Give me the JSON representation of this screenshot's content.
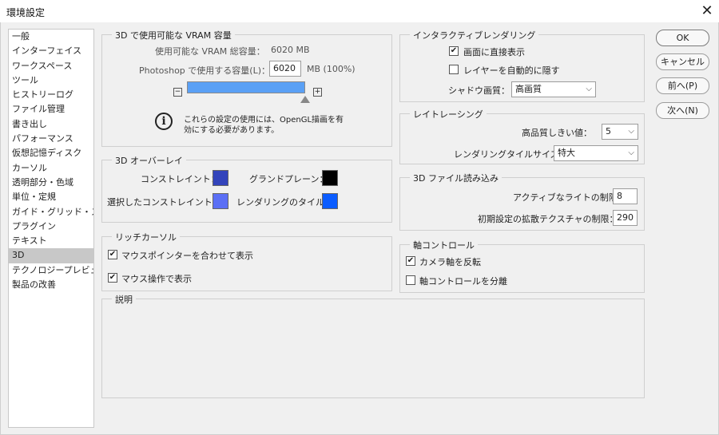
{
  "window": {
    "title": "環境設定",
    "close_glyph": "✕"
  },
  "sidebar": {
    "items": [
      {
        "label": "一般"
      },
      {
        "label": "インターフェイス"
      },
      {
        "label": "ワークスペース"
      },
      {
        "label": "ツール"
      },
      {
        "label": "ヒストリーログ"
      },
      {
        "label": "ファイル管理"
      },
      {
        "label": "書き出し"
      },
      {
        "label": "パフォーマンス"
      },
      {
        "label": "仮想記憶ディスク"
      },
      {
        "label": "カーソル"
      },
      {
        "label": "透明部分・色域"
      },
      {
        "label": "単位・定規"
      },
      {
        "label": "ガイド・グリッド・スライス"
      },
      {
        "label": "プラグイン"
      },
      {
        "label": "テキスト"
      },
      {
        "label": "3D"
      },
      {
        "label": "テクノロジープレビュー"
      },
      {
        "label": "製品の改善"
      }
    ],
    "selected": "3D"
  },
  "vram": {
    "legend": "3D で使用可能な VRAM 容量",
    "available_label": "使用可能な VRAM 総容量：",
    "available_value": "6020 MB",
    "use_label": "Photoshop で使用する容量(L)：",
    "use_value": "6020",
    "use_suffix": "MB (100%)",
    "slider_percent": 100,
    "slider_color": "#5aa0f5",
    "minus": "−",
    "plus": "+",
    "info_icon": "info-icon",
    "info_text_1": "これらの設定の使用には、OpenGL描画を有",
    "info_text_2": "効にする必要があります。"
  },
  "overlay": {
    "legend": "3D オーバーレイ",
    "constraint_label": "コンストレイント：",
    "constraint_color": "#3344bb",
    "ground_label": "グランドプレーン：",
    "ground_color": "#000000",
    "selected_constraint_label": "選択したコンストレイント：",
    "selected_constraint_color": "#5b6ff5",
    "render_tile_label": "レンダリングのタイル：",
    "render_tile_color": "#0a5cff"
  },
  "rich_cursor": {
    "legend": "リッチカーソル",
    "opt1": "マウスポインターを合わせて表示",
    "opt2": "マウス操作で表示"
  },
  "interactive": {
    "legend": "インタラクティブレンダリング",
    "opt1": "画面に直接表示",
    "opt2": "レイヤーを自動的に隠す",
    "shadow_label": "シャドウ画質：",
    "shadow_value": "高画質"
  },
  "raytrace": {
    "legend": "レイトレーシング",
    "threshold_label": "高品質しきい値：",
    "threshold_value": "5",
    "tile_label": "レンダリングタイルサイズ：",
    "tile_value": "特大"
  },
  "fileload": {
    "legend": "3D ファイル読み込み",
    "lights_label": "アクティブなライトの制限：",
    "lights_value": "8",
    "texture_label": "初期設定の拡散テクスチャの制限：",
    "texture_value": "290"
  },
  "axis": {
    "legend": "軸コントロール",
    "opt1": "カメラ軸を反転",
    "opt2": "軸コントロールを分離"
  },
  "description": {
    "legend": "説明"
  },
  "buttons": {
    "ok": "OK",
    "cancel": "キャンセル",
    "prev": "前へ(P)",
    "next": "次へ(N)"
  },
  "glyphs": {
    "check": "✔",
    "chevron": "⌵"
  }
}
